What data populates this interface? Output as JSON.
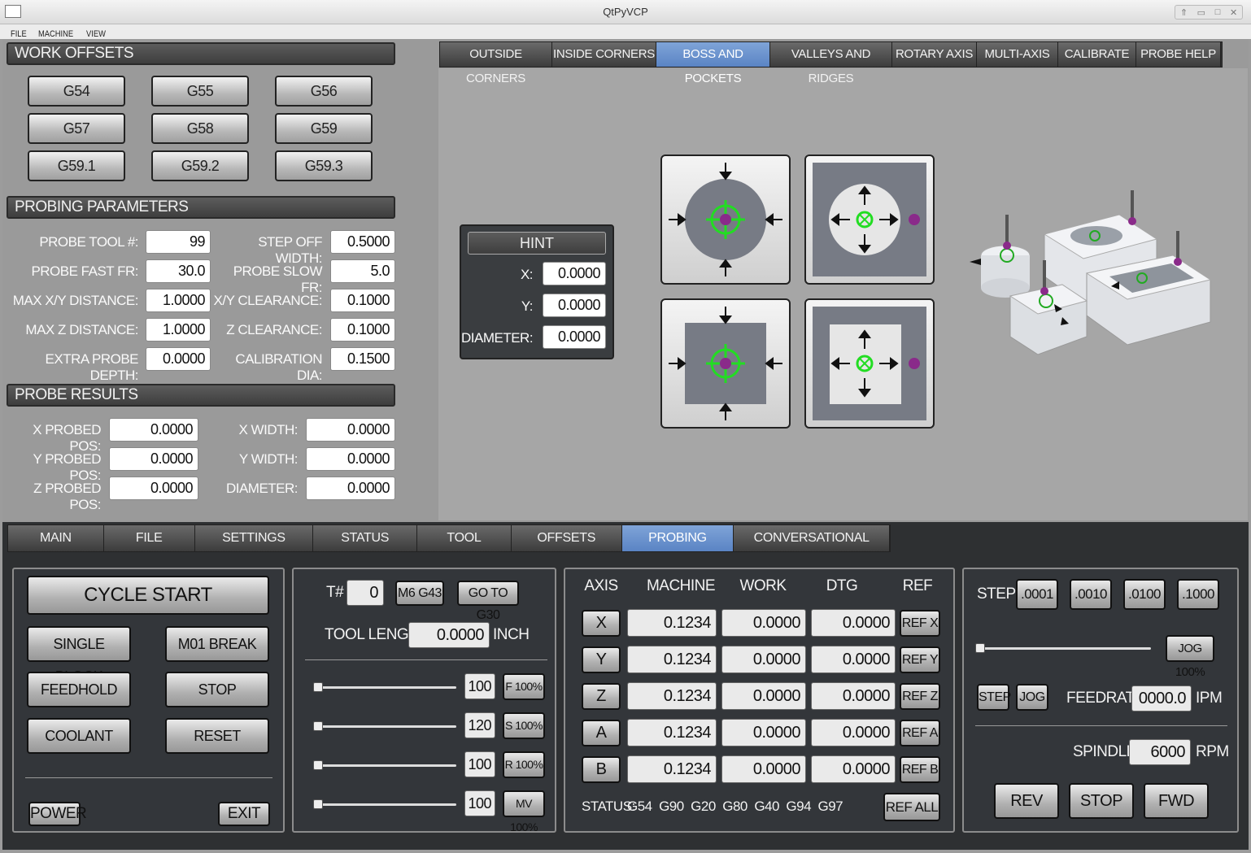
{
  "window": {
    "title": "QtPyVCP"
  },
  "menu": [
    "FILE",
    "MACHINE",
    "VIEW"
  ],
  "work_offsets": {
    "heading": "WORK OFFSETS",
    "buttons": [
      "G54",
      "G55",
      "G56",
      "G57",
      "G58",
      "G59",
      "G59.1",
      "G59.2",
      "G59.3"
    ]
  },
  "probing_params": {
    "heading": "PROBING PARAMETERS",
    "left": [
      {
        "label": "PROBE TOOL #:",
        "value": "99"
      },
      {
        "label": "PROBE FAST FR:",
        "value": "30.0"
      },
      {
        "label": "MAX X/Y DISTANCE:",
        "value": "1.0000"
      },
      {
        "label": "MAX Z DISTANCE:",
        "value": "1.0000"
      },
      {
        "label": "EXTRA PROBE DEPTH:",
        "value": "0.0000"
      }
    ],
    "right": [
      {
        "label": "STEP OFF WIDTH:",
        "value": "0.5000"
      },
      {
        "label": "PROBE SLOW FR:",
        "value": "5.0"
      },
      {
        "label": "X/Y CLEARANCE:",
        "value": "0.1000"
      },
      {
        "label": "Z CLEARANCE:",
        "value": "0.1000"
      },
      {
        "label": "CALIBRATION DIA:",
        "value": "0.1500"
      }
    ]
  },
  "probe_results": {
    "heading": "PROBE RESULTS",
    "left": [
      {
        "label": "X PROBED POS:",
        "value": "0.0000"
      },
      {
        "label": "Y PROBED POS:",
        "value": "0.0000"
      },
      {
        "label": "Z PROBED POS:",
        "value": "0.0000"
      }
    ],
    "right": [
      {
        "label": "X WIDTH:",
        "value": "0.0000"
      },
      {
        "label": "Y WIDTH:",
        "value": "0.0000"
      },
      {
        "label": "DIAMETER:",
        "value": "0.0000"
      }
    ]
  },
  "probe_tabs": {
    "items": [
      "OUTSIDE CORNERS",
      "INSIDE CORNERS",
      "BOSS AND POCKETS",
      "VALLEYS AND RIDGES",
      "ROTARY AXIS",
      "MULTI-AXIS",
      "CALIBRATE",
      "PROBE HELP"
    ],
    "active": "BOSS AND POCKETS"
  },
  "hint": {
    "title": "HINT",
    "rows": [
      {
        "label": "X:",
        "value": "0.0000"
      },
      {
        "label": "Y:",
        "value": "0.0000"
      },
      {
        "label": "DIAMETER:",
        "value": "0.0000"
      }
    ]
  },
  "main_tabs": {
    "items": [
      "MAIN",
      "FILE",
      "SETTINGS",
      "STATUS",
      "TOOL",
      "OFFSETS",
      "PROBING",
      "CONVERSATIONAL"
    ],
    "active": "PROBING"
  },
  "program": {
    "cycle_start": "CYCLE START",
    "single_block": "SINGLE BLOCK",
    "m01_break": "M01 BREAK",
    "feedhold": "FEEDHOLD",
    "stop": "STOP",
    "coolant": "COOLANT",
    "reset": "RESET",
    "power": "POWER",
    "exit": "EXIT"
  },
  "tool": {
    "t_label": "T#",
    "t_value": "0",
    "m6g43": "M6 G43",
    "goto_g30": "GO TO G30",
    "tool_length_label": "TOOL LENGTH",
    "tool_length_value": "0.0000",
    "unit": "INCH",
    "overrides": [
      {
        "value": "100",
        "button": "F 100%",
        "level": 0
      },
      {
        "value": "120",
        "button": "S 100%",
        "level": 0
      },
      {
        "value": "100",
        "button": "R 100%",
        "level": 0
      },
      {
        "value": "100",
        "button": "MV 100%",
        "level": 0
      }
    ]
  },
  "dro": {
    "headers": [
      "AXIS",
      "MACHINE",
      "WORK",
      "DTG",
      "REF"
    ],
    "rows": [
      {
        "axis": "X",
        "machine": "0.1234",
        "work": "0.0000",
        "dtg": "0.0000",
        "ref": "REF X"
      },
      {
        "axis": "Y",
        "machine": "0.1234",
        "work": "0.0000",
        "dtg": "0.0000",
        "ref": "REF Y"
      },
      {
        "axis": "Z",
        "machine": "0.1234",
        "work": "0.0000",
        "dtg": "0.0000",
        "ref": "REF Z"
      },
      {
        "axis": "A",
        "machine": "0.1234",
        "work": "0.0000",
        "dtg": "0.0000",
        "ref": "REF A"
      },
      {
        "axis": "B",
        "machine": "0.1234",
        "work": "0.0000",
        "dtg": "0.0000",
        "ref": "REF B"
      }
    ],
    "status_label": "STATUS:",
    "status_codes": "G54  G90  G20  G80  G40  G94  G97",
    "ref_all": "REF ALL"
  },
  "jog": {
    "step_label": "STEP",
    "steps": [
      ".0001",
      ".0010",
      ".0100",
      ".1000"
    ],
    "jog_pct": "JOG 100%",
    "jog_level": 0,
    "step_btn": "STEP",
    "jog_btn": "JOG",
    "feedrate_label": "FEEDRATE",
    "feedrate_value": "0000.0",
    "feedrate_unit": "IPM",
    "spindle_label": "SPINDLE",
    "spindle_value": "6000",
    "spindle_unit": "RPM",
    "rev": "REV",
    "stop": "STOP",
    "fwd": "FWD"
  },
  "colors": {
    "active_tab": "#6c93cf",
    "probe_green": "#22dd22",
    "probe_ball": "#8a2a8a"
  }
}
